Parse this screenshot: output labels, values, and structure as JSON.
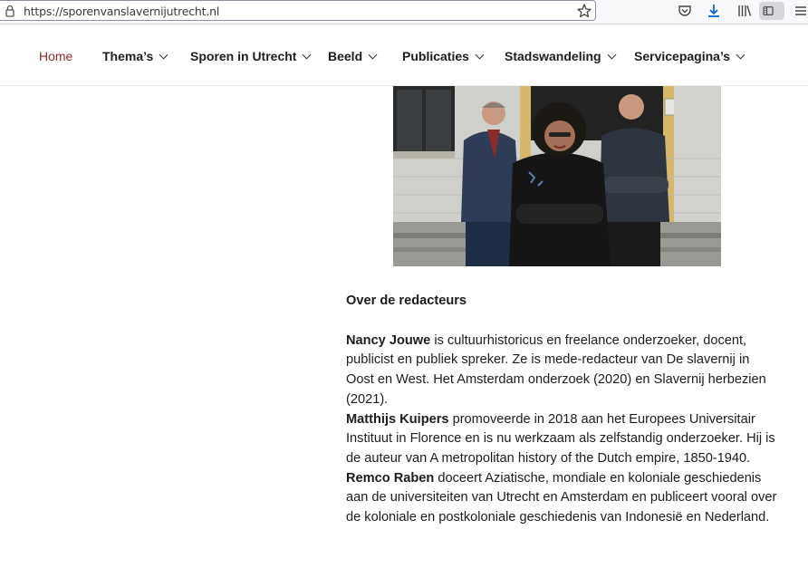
{
  "browser": {
    "url": "https://sporenvanslavernijutrecht.nl",
    "icons": [
      "lock-icon",
      "star-icon",
      "pocket-icon",
      "download-icon",
      "library-icon",
      "sidebar-icon",
      "menu-icon"
    ]
  },
  "nav": {
    "items": [
      {
        "label": "Home",
        "has_dropdown": false,
        "active": true
      },
      {
        "label": "Thema’s",
        "has_dropdown": true
      },
      {
        "label": "Sporen in Utrecht",
        "has_dropdown": true
      },
      {
        "label": "Beeld",
        "has_dropdown": true
      },
      {
        "label": "Publicaties",
        "has_dropdown": true
      },
      {
        "label": "Stadswandeling",
        "has_dropdown": true
      },
      {
        "label": "Servicepagina’s",
        "has_dropdown": true
      }
    ],
    "active_color": "#8b2a2a"
  },
  "article": {
    "heading": "Over de redacteurs",
    "bios": [
      {
        "name": "Nancy Jouwe",
        "text": " is cultuurhistoricus en freelance onderzoeker, docent, publicist en publiek spreker. Ze is mede-redacteur van De slavernij in Oost en West. Het Amsterdam onderzoek (2020) en Slavernij herbezien (2021)."
      },
      {
        "name": "Matthijs Kuipers",
        "text": " promoveerde in 2018 aan het Europees Universitair Instituut in Florence en is nu werkzaam als zelfstandig onderzoeker. Hij is de auteur van A metropolitan history of the Dutch empire, 1850-1940."
      },
      {
        "name": "Remco Raben",
        "text": " doceert Aziatische, mondiale en koloniale geschiedenis aan de universiteiten van Utrecht en Amsterdam en publiceert vooral over de koloniale en postkoloniale geschiedenis van Indonesië en Nederland."
      }
    ]
  }
}
